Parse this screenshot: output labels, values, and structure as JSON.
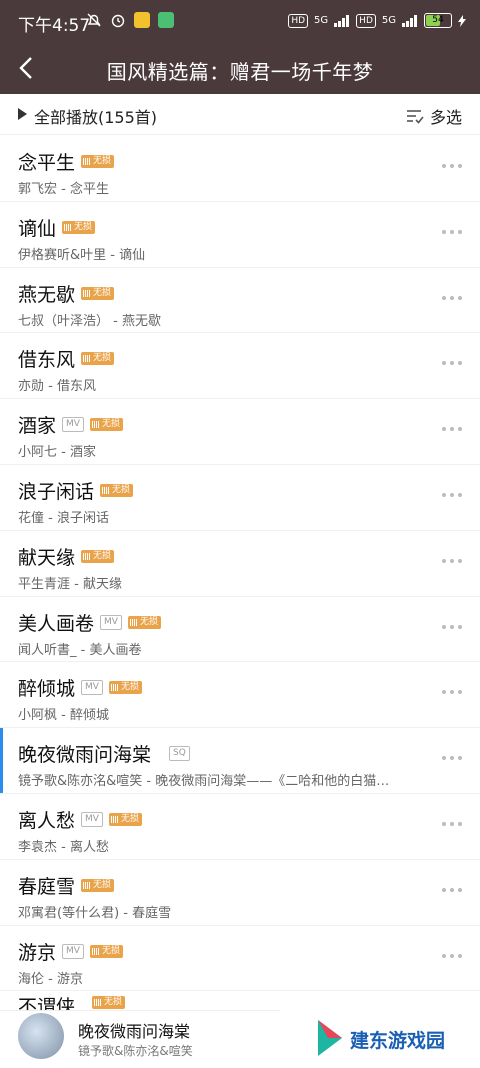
{
  "status_bar": {
    "time": "下午4:57",
    "network_1": "5G",
    "network_2": "5G",
    "hd": "HD",
    "battery": "54",
    "battery_level": 0.54
  },
  "header": {
    "title": "国风精选篇：赠君一场千年梦"
  },
  "toolbar": {
    "play_all": "全部播放(155首)",
    "multi_select": "多选"
  },
  "badges": {
    "wusun": "无损",
    "mv": "MV",
    "sq": "SQ"
  },
  "songs": [
    {
      "title": "念平生",
      "subtitle": "郭飞宏 - 念平生"
    },
    {
      "title": "谪仙",
      "subtitle": "伊格赛听&叶里 - 谪仙"
    },
    {
      "title": "燕无歇",
      "subtitle": "七叔（叶泽浩） - 燕无歇"
    },
    {
      "title": "借东风",
      "subtitle": "亦勋 - 借东风"
    },
    {
      "title": "酒家",
      "subtitle": "小阿七 - 酒家"
    },
    {
      "title": "浪子闲话",
      "subtitle": "花僮 - 浪子闲话"
    },
    {
      "title": "献天缘",
      "subtitle": "平生青涯 - 献天缘"
    },
    {
      "title": "美人画卷",
      "subtitle": "闻人听書_ - 美人画卷"
    },
    {
      "title": "醉倾城",
      "subtitle": "小阿枫 - 醉倾城"
    },
    {
      "title": "晚夜微雨问海棠",
      "subtitle": "镜予歌&陈亦洺&喧笑 - 晚夜微雨问海棠——《二哈和他的白猫…"
    },
    {
      "title": "离人愁",
      "subtitle": "李袁杰 - 离人愁"
    },
    {
      "title": "春庭雪",
      "subtitle": "邓寓君(等什么君) - 春庭雪"
    },
    {
      "title": "游京",
      "subtitle": "海伦 - 游京"
    },
    {
      "title": "不谓侠"
    }
  ],
  "now_playing": {
    "title": "晚夜微雨问海棠",
    "artist": "镜予歌&陈亦洺&喧笑"
  },
  "watermark": {
    "text": "建东游戏园"
  },
  "colors": {
    "header_bg": "#4a3a3c",
    "wusun_badge": "#e9a34b",
    "active_indicator": "#2d8cf0",
    "watermark_text": "#1a5fb4"
  }
}
